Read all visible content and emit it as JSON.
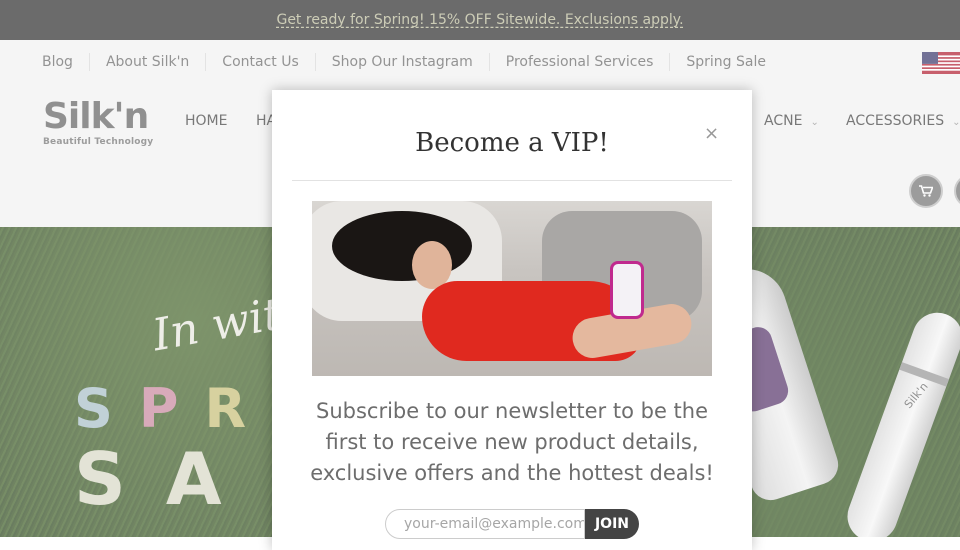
{
  "announcement": {
    "text": "Get ready for Spring! 15% OFF Sitewide. Exclusions apply."
  },
  "topnav": {
    "items": [
      {
        "label": "Blog"
      },
      {
        "label": "About Silk'n"
      },
      {
        "label": "Contact Us"
      },
      {
        "label": "Shop Our Instagram"
      },
      {
        "label": "Professional Services"
      },
      {
        "label": "Spring Sale"
      }
    ]
  },
  "flag": {
    "icon": "us-flag-icon"
  },
  "logo": {
    "word": "Silk'n",
    "tagline": "Beautiful Technology"
  },
  "mainnav": {
    "items": [
      {
        "label": "HOME"
      },
      {
        "label": "HA"
      },
      {
        "label": "ACNE"
      },
      {
        "label": "ACCESSORIES"
      }
    ]
  },
  "cart": {
    "icon": "shopping-cart-icon"
  },
  "hero": {
    "script_text": "In with",
    "spring_letters": [
      "S",
      "P",
      "R"
    ],
    "spring_colors": [
      "#a9c0c8",
      "#c98aa0",
      "#c8c07a"
    ],
    "sale_letters": [
      "S",
      "A"
    ],
    "device_brand": "Silk'n"
  },
  "modal": {
    "title": "Become a VIP!",
    "close": "×",
    "body": "Subscribe to our newsletter to be the first to receive new product details, exclusive offers and the hottest deals!",
    "email_placeholder": "your-email@example.com",
    "join_label": "JOIN"
  }
}
